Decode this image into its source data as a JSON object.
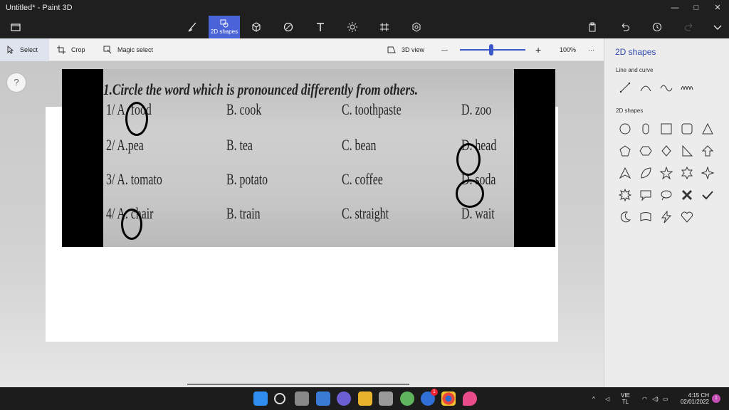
{
  "window": {
    "title": "Untitled* - Paint 3D",
    "min": "—",
    "max": "□",
    "close": "✕"
  },
  "ribbon": {
    "active_label": "2D shapes"
  },
  "toolbar": {
    "select": "Select",
    "crop": "Crop",
    "magic_select": "Magic select",
    "view3d": "3D view",
    "zoom_minus": "—",
    "zoom_plus": "+",
    "zoom": "100%",
    "more": "···"
  },
  "zoom_level": 0.48,
  "canvas": {
    "help": "?",
    "heading": "1.Circle the word which is pronounced differently from others.",
    "rows": [
      [
        "1/ A. food",
        "B. cook",
        "C. toothpaste",
        "D. zoo"
      ],
      [
        "2/ A.pea",
        "B. tea",
        "C. bean",
        "D. head"
      ],
      [
        "3/ A. tomato",
        "B. potato",
        "C. coffee",
        "D. soda"
      ],
      [
        "4/ A. chair",
        "B. train",
        "C. straight",
        "D. wait"
      ]
    ]
  },
  "panel": {
    "title": "2D shapes",
    "line_section": "Line and curve",
    "shape_section": "2D shapes",
    "line_icons": [
      "line-icon",
      "curve-icon",
      "wave-icon",
      "zigzag-curve-icon"
    ],
    "shape_icons": [
      "circle-icon",
      "capsule-icon",
      "square-icon",
      "rounded-square-icon",
      "triangle-icon",
      "pentagon-icon",
      "hexagon-icon",
      "diamond-icon",
      "right-triangle-icon",
      "arrow-up-icon",
      "sharp-triangle-icon",
      "leaf-icon",
      "star5-icon",
      "star6-icon",
      "star4-icon",
      "burst-icon",
      "speech-bubble-icon",
      "thought-bubble-icon",
      "cross-icon",
      "check-icon",
      "moon-icon",
      "banner-icon",
      "lightning-icon",
      "heart-icon"
    ]
  },
  "taskbar": {
    "lang": "VIE",
    "layout": "TL",
    "time": "4:15 CH",
    "date": "02/01/2022",
    "notif": "1",
    "badge": "1"
  },
  "colors": {
    "accent": "#4b63d9",
    "panel_title": "#3047b0"
  }
}
